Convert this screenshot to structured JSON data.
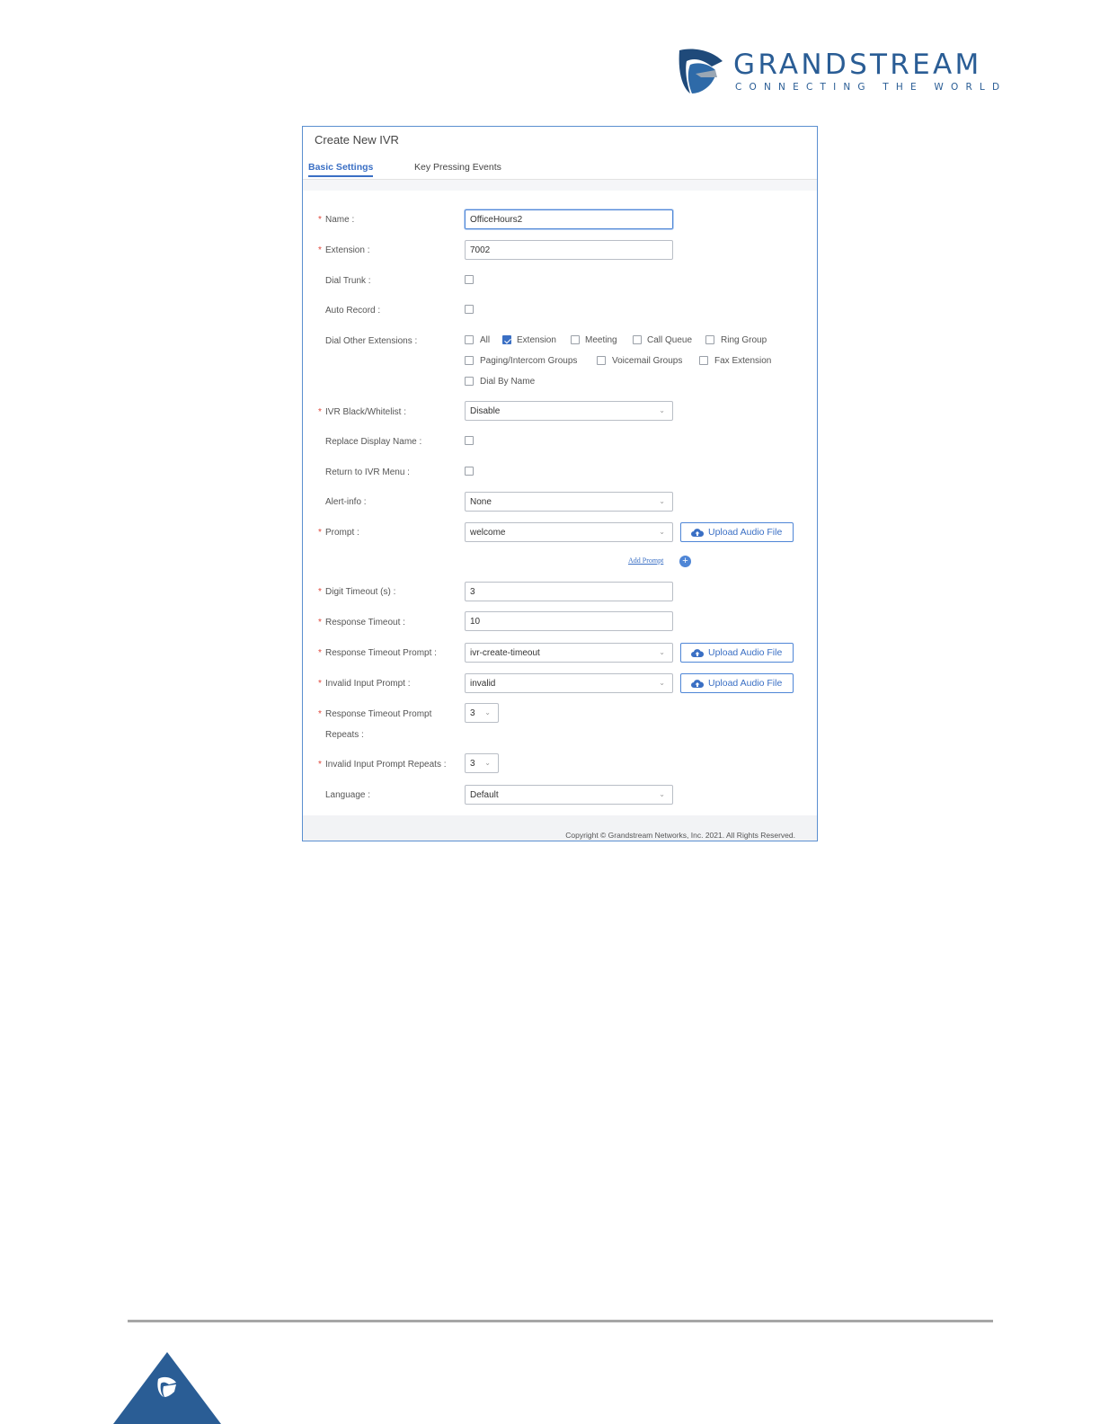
{
  "brand": {
    "name": "GRANDSTREAM",
    "tagline": "CONNECTING THE WORLD",
    "color": "#2a5d95"
  },
  "dialog": {
    "title": "Create New IVR",
    "tabs": [
      "Basic Settings",
      "Key Pressing Events"
    ],
    "fields": {
      "name": {
        "label": "Name :",
        "value": "OfficeHours2"
      },
      "extension": {
        "label": "Extension :",
        "value": "7002"
      },
      "dial_trunk": {
        "label": "Dial Trunk :",
        "checked": false
      },
      "auto_record": {
        "label": "Auto Record :",
        "checked": false
      },
      "dial_other": {
        "label": "Dial Other Extensions :",
        "options": [
          {
            "label": "All",
            "checked": false
          },
          {
            "label": "Extension",
            "checked": true
          },
          {
            "label": "Meeting",
            "checked": false
          },
          {
            "label": "Call Queue",
            "checked": false
          },
          {
            "label": "Ring Group",
            "checked": false
          },
          {
            "label": "Paging/Intercom Groups",
            "checked": false
          },
          {
            "label": "Voicemail Groups",
            "checked": false
          },
          {
            "label": "Fax Extension",
            "checked": false
          },
          {
            "label": "Dial By Name",
            "checked": false
          }
        ]
      },
      "blackwhitelist": {
        "label": "IVR Black/Whitelist :",
        "value": "Disable"
      },
      "replace_display_name": {
        "label": "Replace Display Name :",
        "checked": false
      },
      "return_to_ivr": {
        "label": "Return to IVR Menu :",
        "checked": false
      },
      "alert_info": {
        "label": "Alert-info :",
        "value": "None"
      },
      "prompt": {
        "label": "Prompt :",
        "value": "welcome"
      },
      "add_prompt": "Add Prompt",
      "digit_timeout": {
        "label": "Digit Timeout (s) :",
        "value": "3"
      },
      "response_timeout": {
        "label": "Response Timeout :",
        "value": "10"
      },
      "response_timeout_prompt": {
        "label": "Response Timeout Prompt :",
        "value": "ivr-create-timeout"
      },
      "invalid_input_prompt": {
        "label": "Invalid Input Prompt :",
        "value": "invalid"
      },
      "response_timeout_repeats": {
        "label_line1": "Response Timeout Prompt",
        "label_line2": "Repeats :",
        "value": "3"
      },
      "invalid_input_repeats": {
        "label": "Invalid Input Prompt Repeats :",
        "value": "3"
      },
      "language": {
        "label": "Language :",
        "value": "Default"
      }
    },
    "upload_label": "Upload Audio File",
    "copyright": "Copyright © Grandstream Networks, Inc. 2021. All Rights Reserved."
  },
  "colors": {
    "accent": "#3a6fc4",
    "required": "#e0463a"
  }
}
